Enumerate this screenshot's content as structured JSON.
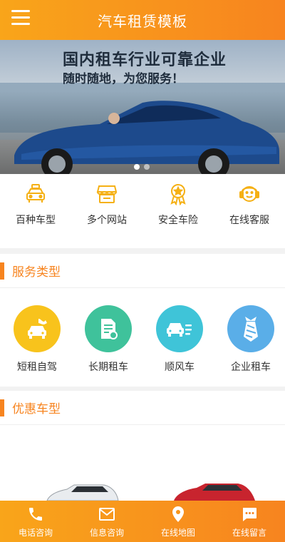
{
  "header": {
    "title": "汽车租赁模板"
  },
  "banner": {
    "headline": "国内租车行业可靠企业",
    "subline": "随时随地，为您服务！",
    "slide_count": 2,
    "active_slide": 1
  },
  "quick_links": [
    {
      "label": "百种车型",
      "icon": "taxi-icon"
    },
    {
      "label": "多个网站",
      "icon": "store-icon"
    },
    {
      "label": "安全车险",
      "icon": "medal-icon"
    },
    {
      "label": "在线客服",
      "icon": "headset-icon"
    }
  ],
  "services": {
    "title": "服务类型",
    "items": [
      {
        "label": "短租自驾",
        "icon": "car-wash-icon",
        "color": "#f8c31c"
      },
      {
        "label": "长期租车",
        "icon": "contract-icon",
        "color": "#3fc29b"
      },
      {
        "label": "顺风车",
        "icon": "car-speed-icon",
        "color": "#3fc4d8"
      },
      {
        "label": "企业租车",
        "icon": "tie-icon",
        "color": "#5aaee8"
      }
    ]
  },
  "cars": {
    "title": "优惠车型"
  },
  "footer": {
    "items": [
      {
        "label": "电话咨询",
        "icon": "phone-icon"
      },
      {
        "label": "信息咨询",
        "icon": "mail-icon"
      },
      {
        "label": "在线地图",
        "icon": "map-pin-icon"
      },
      {
        "label": "在线留言",
        "icon": "chat-icon"
      }
    ]
  },
  "colors": {
    "brand": "#f7841f",
    "brand_light": "#f9a51a",
    "quick_icon": "#f5b014"
  }
}
